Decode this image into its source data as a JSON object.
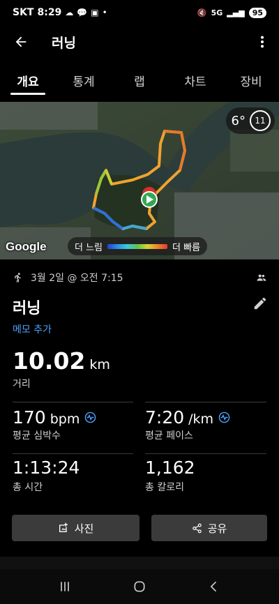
{
  "status": {
    "carrier": "SKT",
    "time": "8:29",
    "network": "5G",
    "battery": "95"
  },
  "appbar": {
    "title": "러닝"
  },
  "tabs": [
    {
      "label": "개요"
    },
    {
      "label": "통계"
    },
    {
      "label": "랩"
    },
    {
      "label": "차트"
    },
    {
      "label": "장비"
    }
  ],
  "map": {
    "weather_temp": "6°",
    "weather_wind": "11",
    "google_label": "Google",
    "legend_slow": "더 느림",
    "legend_fast": "더 빠름"
  },
  "activity": {
    "date": "3월 2일 @ 오전 7:15",
    "name": "러닝",
    "memo_link": "메모 추가",
    "distance_value": "10.02",
    "distance_unit": "km",
    "distance_label": "거리",
    "heart_value": "170",
    "heart_unit": "bpm",
    "heart_label": "평균 심박수",
    "pace_value": "7:20",
    "pace_unit": "/km",
    "pace_label": "평균 페이스",
    "time_value": "1:13:24",
    "time_label": "총 시간",
    "cal_value": "1,162",
    "cal_label": "총 칼로리"
  },
  "buttons": {
    "photo": "사진",
    "share": "공유"
  },
  "colors": {
    "link": "#4da3ff",
    "button_bg": "#3b3b3b"
  }
}
